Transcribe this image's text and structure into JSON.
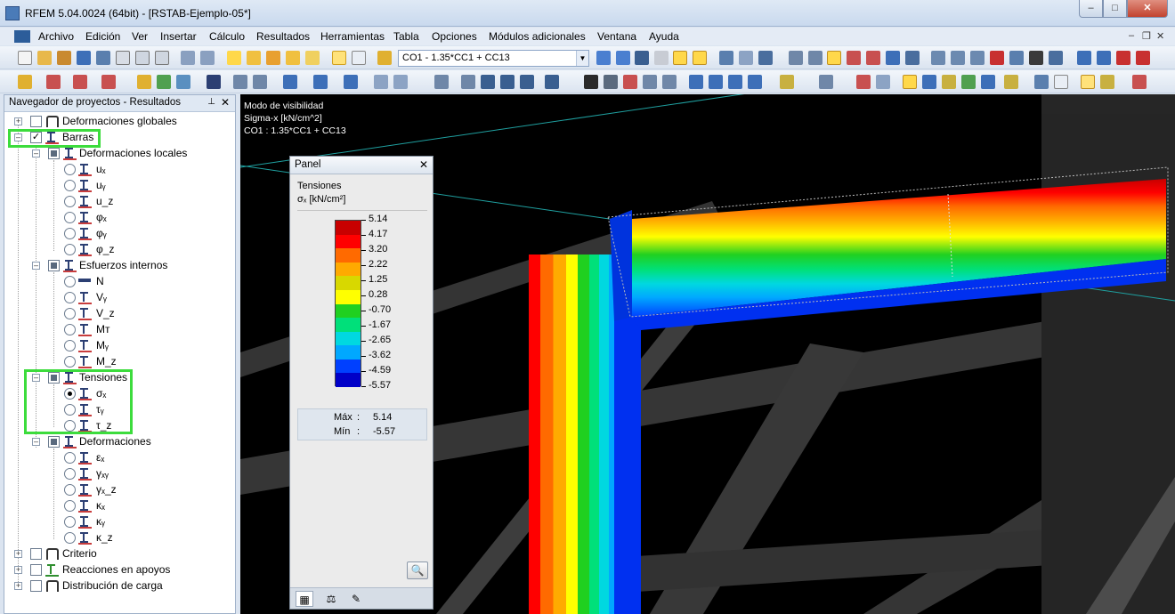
{
  "window": {
    "title": "RFEM 5.04.0024 (64bit) - [RSTAB-Ejemplo-05*]",
    "min": "–",
    "max": "□",
    "close": "✕"
  },
  "menu": [
    "Archivo",
    "Edición",
    "Ver",
    "Insertar",
    "Cálculo",
    "Resultados",
    "Herramientas",
    "Tabla",
    "Opciones",
    "Módulos adicionales",
    "Ventana",
    "Ayuda"
  ],
  "mdi": {
    "min": "–",
    "restore": "❐",
    "close": "✕"
  },
  "toolbar": {
    "load_combo": "CO1 - 1.35*CC1 + CC13"
  },
  "navigator": {
    "title": "Navegador de proyectos - Resultados",
    "pin": "⊥",
    "close": "✕",
    "items": {
      "def_global": "Deformaciones globales",
      "barras": "Barras",
      "def_locales": "Deformaciones locales",
      "ux": "uₓ",
      "uy": "uᵧ",
      "uz": "u_z",
      "phix": "φₓ",
      "phiy": "φᵧ",
      "phiz": "φ_z",
      "esfuerzos": "Esfuerzos internos",
      "N": "N",
      "Vy": "Vᵧ",
      "Vz": "V_z",
      "MT": "Mᴛ",
      "My": "Mᵧ",
      "Mz": "M_z",
      "tensiones": "Tensiones",
      "sx": "σₓ",
      "ty": "τᵧ",
      "tz": "τ_z",
      "deformaciones": "Deformaciones",
      "ex": "εₓ",
      "gxy": "γₓᵧ",
      "gxz": "γₓ_z",
      "kx": "κₓ",
      "ky": "κᵧ",
      "kz": "κ_z",
      "criterio": "Criterio",
      "reacciones": "Reacciones en apoyos",
      "distribucion": "Distribución de carga"
    }
  },
  "viewport": {
    "line1": "Modo de visibilidad",
    "line2": "Sigma-x [kN/cm^2]",
    "line3": "CO1 : 1.35*CC1 + CC13"
  },
  "panel": {
    "title": "Panel",
    "close": "✕",
    "heading": "Tensiones",
    "unit": "σₓ [kN/cm²]",
    "scale_values": [
      "5.14",
      "4.17",
      "3.20",
      "2.22",
      "1.25",
      "0.28",
      "-0.70",
      "-1.67",
      "-2.65",
      "-3.62",
      "-4.59",
      "-5.57"
    ],
    "scale_colors": [
      "#c80000",
      "#ff0000",
      "#ff6a00",
      "#ffaa00",
      "#d8d800",
      "#ffff00",
      "#20d020",
      "#00e07a",
      "#00d8e0",
      "#00a8ff",
      "#0040ff",
      "#0000c8"
    ],
    "max_label": "Máx",
    "max_value": "5.14",
    "min_label": "Mín",
    "min_value": "-5.57",
    "sep": ":",
    "zoom": "🔍"
  }
}
